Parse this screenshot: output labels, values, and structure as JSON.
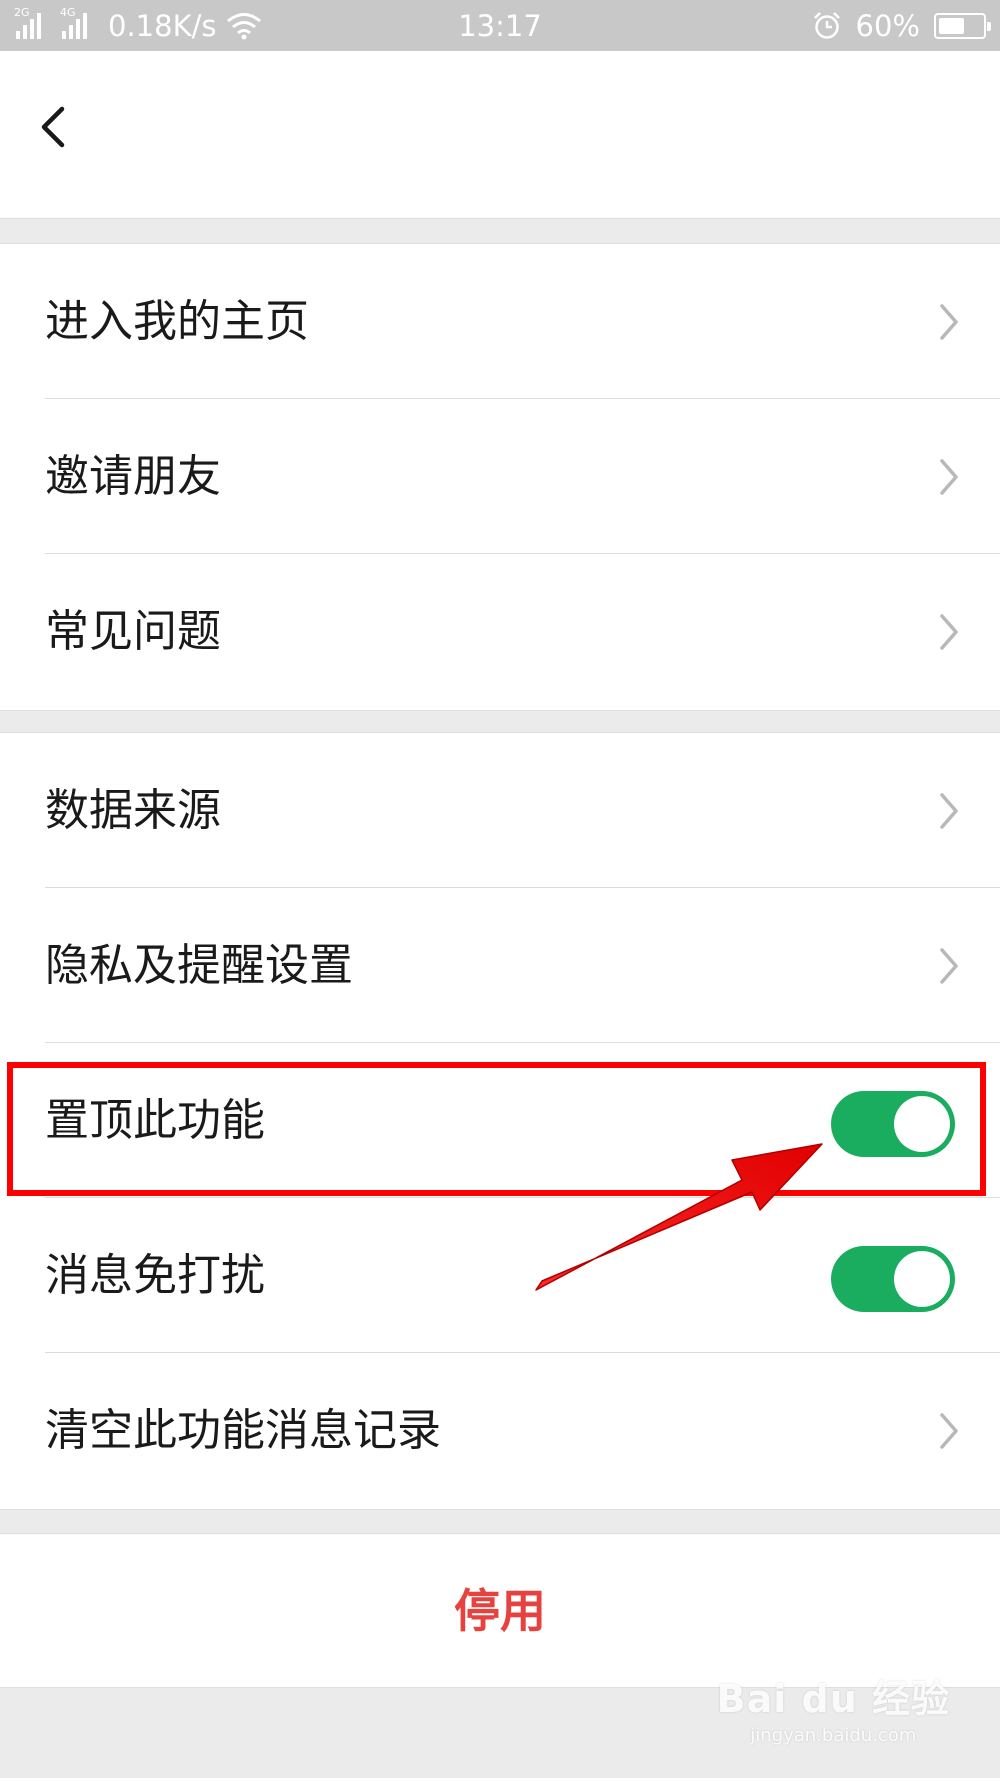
{
  "status_bar": {
    "network_1": "2G",
    "network_2": "4G",
    "speed": "0.18K/s",
    "time": "13:17",
    "battery_percent": "60%",
    "battery_level": 0.6
  },
  "nav": {
    "back_icon": "chevron-left-icon"
  },
  "group1": [
    {
      "label": "进入我的主页",
      "control": "chevron"
    },
    {
      "label": "邀请朋友",
      "control": "chevron"
    },
    {
      "label": "常见问题",
      "control": "chevron"
    }
  ],
  "group2": [
    {
      "label": "数据来源",
      "control": "chevron"
    },
    {
      "label": "隐私及提醒设置",
      "control": "chevron"
    },
    {
      "label": "置顶此功能",
      "control": "switch",
      "on": true
    },
    {
      "label": "消息免打扰",
      "control": "switch",
      "on": true
    },
    {
      "label": "清空此功能消息记录",
      "control": "chevron"
    }
  ],
  "disable_button": "停用",
  "colors": {
    "switch_on": "#1aad5f",
    "danger_text": "#e64340",
    "annotation": "#ff0000"
  },
  "watermark": {
    "logo": "Bai du 经验",
    "url": "jingyan.baidu.com"
  }
}
